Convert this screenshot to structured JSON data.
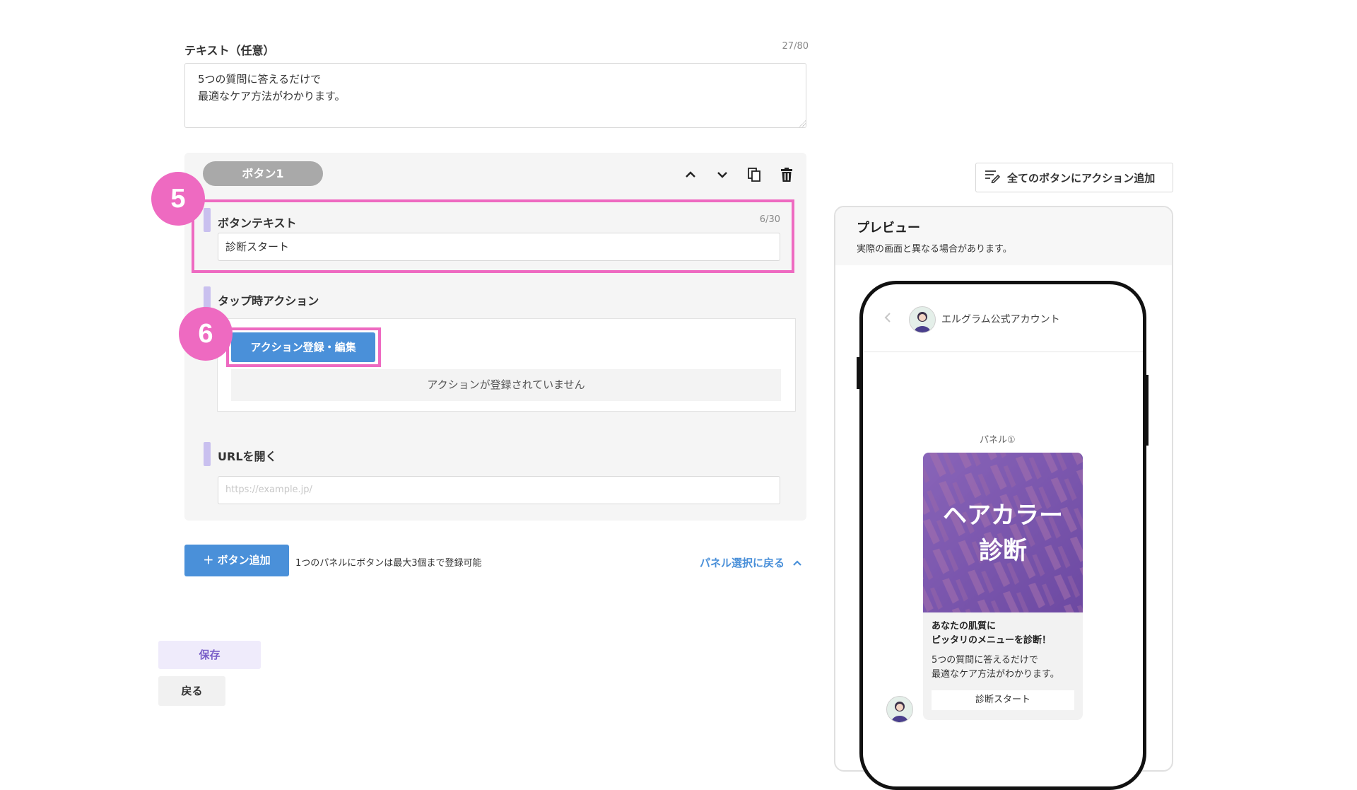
{
  "text_field": {
    "label": "テキスト（任意）",
    "count": "27/80",
    "value": "5つの質問に答えるだけで\n最適なケア方法がわかります。"
  },
  "button_section": {
    "tab_label": "ボタン1",
    "toolbar_icons": [
      "chevron-up-icon",
      "chevron-down-icon",
      "copy-icon",
      "trash-icon"
    ],
    "button_text": {
      "label": "ボタンテキスト",
      "count": "6/30",
      "value": "診断スタート"
    },
    "tap_action": {
      "label": "タップ時アクション",
      "action_button": "アクション登録・編集",
      "empty_message": "アクションが登録されていません"
    },
    "url": {
      "label": "URLを開く",
      "placeholder": "https://example.jp/"
    }
  },
  "annotations": {
    "step5": "5",
    "step6": "6",
    "highlight_color": "#ee6ac1"
  },
  "footer": {
    "add_button": "＋ ボタン追加",
    "note": "1つのパネルにボタンは最大3個まで登録可能",
    "back_link": "パネル選択に戻る",
    "save": "保存",
    "return": "戻る"
  },
  "right": {
    "all_action_button": "全てのボタンにアクション追加",
    "preview_title": "プレビュー",
    "preview_subtitle": "実際の画面と異なる場合があります。",
    "account_name": "エルグラム公式アカウント",
    "panel_label": "パネル①",
    "card": {
      "image_text_line1": "ヘアカラー",
      "image_text_line2": "診断",
      "title": "あなたの肌質に\nピッタリのメニューを診断！",
      "text": "5つの質問に答えるだけで\n最適なケア方法がわかります。",
      "button": "診断スタート"
    }
  },
  "colors": {
    "primary_blue": "#4a90d9",
    "accent_purple": "#c9c0ef",
    "card_purple": "#8a5db8"
  }
}
